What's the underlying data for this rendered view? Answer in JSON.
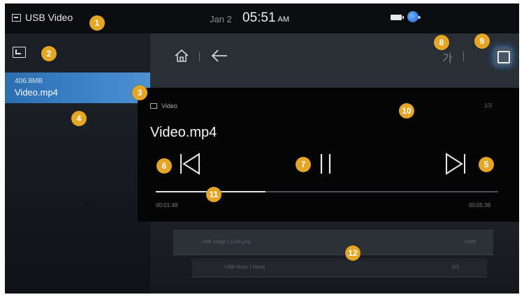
{
  "status_bar": {
    "title": "USB Video",
    "date": "Jan 2",
    "time": "05:51",
    "ampm": "AM",
    "icons": [
      "usb-icon",
      "battery-icon",
      "voice-assistant-icon"
    ]
  },
  "left_panel": {
    "folder_up_icon": "folder-up-icon",
    "file": {
      "size": "406.8MB",
      "name": "Video.mp4"
    }
  },
  "top_bar": {
    "icons": [
      "home-icon",
      "back-icon",
      "korean-keyboard-icon",
      "fullscreen-icon"
    ],
    "ko_label": "가"
  },
  "player": {
    "folder": "Video",
    "count": "1/3",
    "title": "Video.mp4",
    "elapsed": "00:01:48",
    "total": "00:05:36",
    "progress": 0.32
  },
  "list": {
    "row1_left": "USB Image | 1234.png",
    "row1_right": "1/888",
    "row2_left": "USB Music | Music",
    "row2_right": "2/3"
  },
  "callouts": [
    "1",
    "2",
    "3",
    "4",
    "5",
    "6",
    "7",
    "8",
    "9",
    "10",
    "11",
    "12"
  ],
  "colors": {
    "accent": "#3d83c8",
    "callout": "#e5a626"
  }
}
